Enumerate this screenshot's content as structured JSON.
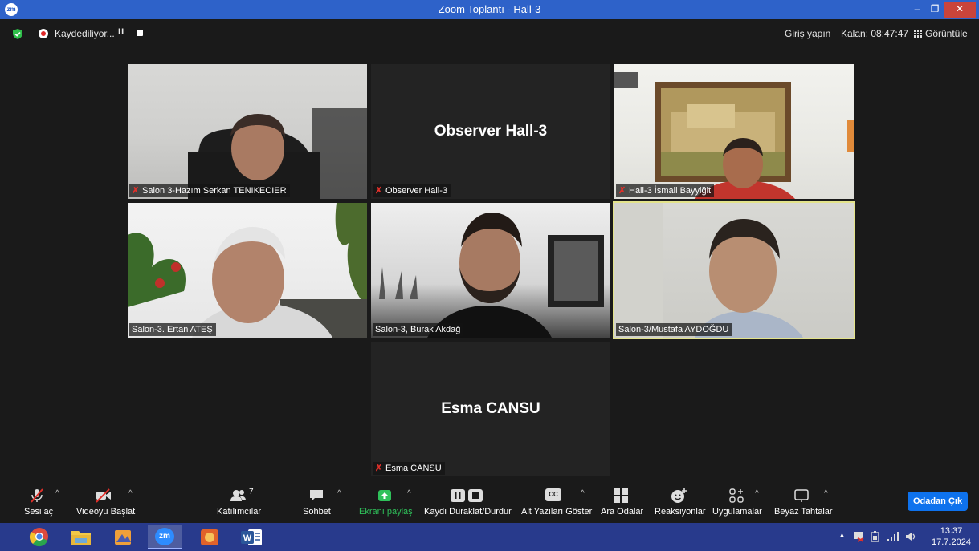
{
  "window": {
    "title": "Zoom Toplantı - Hall-3",
    "app_icon": "zm"
  },
  "topbar": {
    "recording_label": "Kaydediliyor...",
    "login_label": "Giriş yapın",
    "remaining_label": "Kalan: 08:47:47",
    "view_label": "Görüntüle"
  },
  "tiles": [
    {
      "name": "Salon 3-Hazım Serkan TENIKECIER",
      "video": true,
      "muted": true
    },
    {
      "name": "Observer Hall-3",
      "video": false,
      "display_name": "Observer Hall-3",
      "muted": true
    },
    {
      "name": "Hall-3 İsmail Bayyiğit",
      "video": true,
      "muted": true
    },
    {
      "name": "Salon-3. Ertan ATEŞ",
      "video": true,
      "muted": false
    },
    {
      "name": "Salon-3, Burak Akdağ",
      "video": true,
      "muted": false
    },
    {
      "name": "Salon-3/Mustafa AYDOĞDU",
      "video": true,
      "muted": false,
      "active_speaker": true
    },
    {
      "name": "Esma CANSU",
      "video": false,
      "display_name": "Esma CANSU",
      "muted": true
    }
  ],
  "toolbar": {
    "audio_label": "Sesi aç",
    "video_label": "Videoyu Başlat",
    "participants_label": "Katılımcılar",
    "participants_count": "7",
    "chat_label": "Sohbet",
    "share_label": "Ekranı paylaş",
    "record_label": "Kaydı Duraklat/Durdur",
    "captions_label": "Alt Yazıları Göster",
    "captions_icon_text": "CC",
    "rooms_label": "Ara Odalar",
    "reactions_label": "Reaksiyonlar",
    "apps_label": "Uygulamalar",
    "whiteboard_label": "Beyaz Tahtalar",
    "leave_label": "Odadan Çık"
  },
  "taskbar": {
    "apps": [
      "chrome-icon",
      "file-explorer-icon",
      "media-icon",
      "zoom-icon",
      "photo-app-icon",
      "word-icon"
    ],
    "zoom_icon_text": "zm",
    "clock_time": "13:37",
    "clock_date": "17.7.2024"
  },
  "colors": {
    "titlebar": "#2e62c9",
    "share": "#2fc15a",
    "leave": "#0e72ed",
    "active_border": "#e3e38a",
    "taskbar": "#283a8c"
  }
}
